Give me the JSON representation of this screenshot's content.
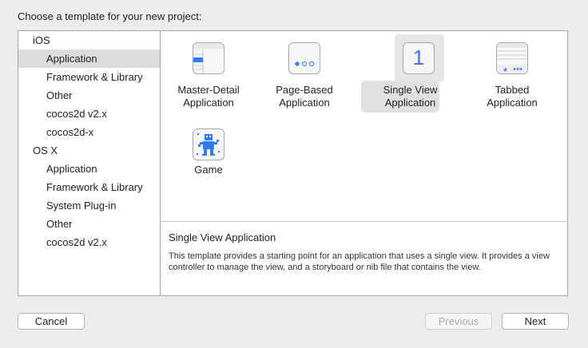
{
  "prompt": "Choose a template for your new project:",
  "sidebar": {
    "groups": [
      {
        "heading": "iOS",
        "items": [
          "Application",
          "Framework & Library",
          "Other",
          "cocos2d v2.x",
          "cocos2d-x"
        ]
      },
      {
        "heading": "OS X",
        "items": [
          "Application",
          "Framework & Library",
          "System Plug-in",
          "Other",
          "cocos2d v2.x"
        ]
      }
    ],
    "selected": "iOS/Application"
  },
  "templates": [
    {
      "line1": "Master-Detail",
      "line2": "Application",
      "icon": "master-detail-icon"
    },
    {
      "line1": "Page-Based",
      "line2": "Application",
      "icon": "page-based-icon"
    },
    {
      "line1": "Single View",
      "line2": "Application",
      "icon": "single-view-icon",
      "glyph": "1",
      "selected": true
    },
    {
      "line1": "Tabbed",
      "line2": "Application",
      "icon": "tabbed-icon"
    },
    {
      "line1": "Game",
      "line2": "",
      "icon": "game-icon"
    }
  ],
  "description": {
    "title": "Single View Application",
    "body": "This template provides a starting point for an application that uses a single view. It provides a view controller to manage the view, and a storyboard or nib file that contains the view."
  },
  "buttons": {
    "cancel": "Cancel",
    "previous": "Previous",
    "next": "Next"
  },
  "colors": {
    "accent": "#2f7cf6",
    "selection": "#dcdcdc"
  }
}
